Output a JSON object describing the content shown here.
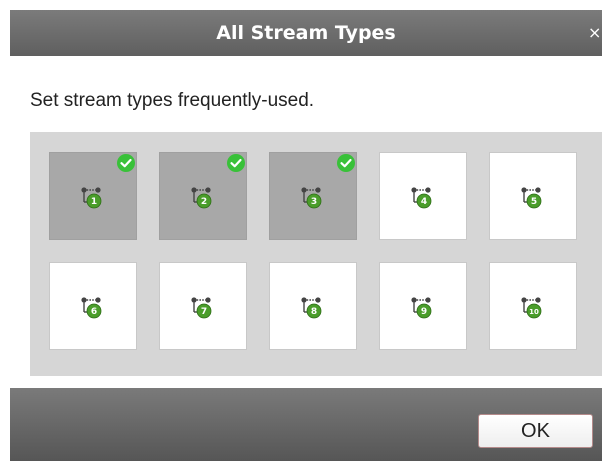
{
  "dialog": {
    "title": "All Stream Types",
    "close_glyph": "×",
    "instruction": "Set stream types frequently-used.",
    "ok_label": "OK"
  },
  "colors": {
    "titlebar": "#6b6b6b",
    "selected_tile": "#a8a8a8",
    "check_green": "#39c139",
    "stream_badge_green": "#4a9d2a"
  },
  "streams": [
    {
      "number": "1",
      "selected": true
    },
    {
      "number": "2",
      "selected": true
    },
    {
      "number": "3",
      "selected": true
    },
    {
      "number": "4",
      "selected": false
    },
    {
      "number": "5",
      "selected": false
    },
    {
      "number": "6",
      "selected": false
    },
    {
      "number": "7",
      "selected": false
    },
    {
      "number": "8",
      "selected": false
    },
    {
      "number": "9",
      "selected": false
    },
    {
      "number": "10",
      "selected": false
    }
  ],
  "icons": {
    "tile": "stream-type-icon",
    "selected_marker": "check-circle-icon"
  }
}
